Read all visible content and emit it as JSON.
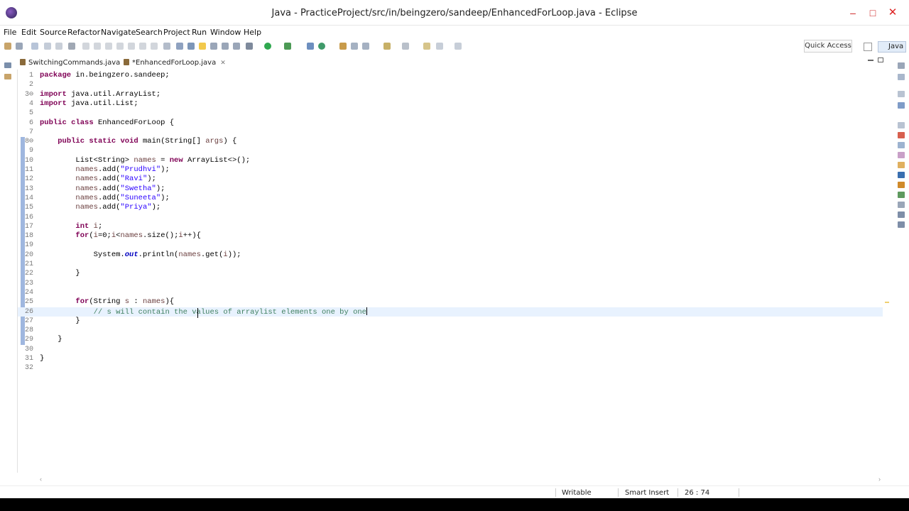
{
  "window": {
    "title": "Java - PracticeProject/src/in/beingzero/sandeep/EnhancedForLoop.java - Eclipse",
    "minimize": "–",
    "maximize": "□",
    "close": "✕"
  },
  "menu": [
    "File",
    "Edit",
    "Source",
    "Refactor",
    "Navigate",
    "Search",
    "Project",
    "Run",
    "Window",
    "Help"
  ],
  "toolbar": {
    "quick_access": "Quick Access",
    "perspective": "Java"
  },
  "tabs": [
    {
      "label": "SwitchingCommands.java",
      "active": false
    },
    {
      "label": "*EnhancedForLoop.java",
      "active": true,
      "close": "✕"
    }
  ],
  "editor": {
    "current_line": 26,
    "lines": [
      {
        "n": "1",
        "tokens": [
          [
            "kw",
            "package"
          ],
          [
            "p",
            " in.beingzero.sandeep;"
          ]
        ]
      },
      {
        "n": "2",
        "tokens": []
      },
      {
        "n": "3⊖",
        "tokens": [
          [
            "kw",
            "import"
          ],
          [
            "p",
            " java.util.ArrayList;"
          ]
        ]
      },
      {
        "n": "4",
        "tokens": [
          [
            "kw",
            "import"
          ],
          [
            "p",
            " java.util.List;"
          ]
        ]
      },
      {
        "n": "5",
        "tokens": []
      },
      {
        "n": "6",
        "tokens": [
          [
            "kw",
            "public"
          ],
          [
            "p",
            " "
          ],
          [
            "kw",
            "class"
          ],
          [
            "p",
            " EnhancedForLoop {"
          ]
        ]
      },
      {
        "n": "7",
        "tokens": []
      },
      {
        "n": "8⊖",
        "tokens": [
          [
            "p",
            "    "
          ],
          [
            "kw",
            "public"
          ],
          [
            "p",
            " "
          ],
          [
            "kw",
            "static"
          ],
          [
            "p",
            " "
          ],
          [
            "kw",
            "void"
          ],
          [
            "p",
            " main(String[] "
          ],
          [
            "var",
            "args"
          ],
          [
            "p",
            ") {"
          ]
        ]
      },
      {
        "n": "9",
        "tokens": []
      },
      {
        "n": "10",
        "tokens": [
          [
            "p",
            "        List<String> "
          ],
          [
            "var",
            "names"
          ],
          [
            "p",
            " = "
          ],
          [
            "kw",
            "new"
          ],
          [
            "p",
            " ArrayList<>();"
          ]
        ]
      },
      {
        "n": "11",
        "tokens": [
          [
            "p",
            "        "
          ],
          [
            "var",
            "names"
          ],
          [
            "p",
            ".add("
          ],
          [
            "str",
            "\"Prudhvi\""
          ],
          [
            "p",
            ");"
          ]
        ]
      },
      {
        "n": "12",
        "tokens": [
          [
            "p",
            "        "
          ],
          [
            "var",
            "names"
          ],
          [
            "p",
            ".add("
          ],
          [
            "str",
            "\"Ravi\""
          ],
          [
            "p",
            ");"
          ]
        ]
      },
      {
        "n": "13",
        "tokens": [
          [
            "p",
            "        "
          ],
          [
            "var",
            "names"
          ],
          [
            "p",
            ".add("
          ],
          [
            "str",
            "\"Swetha\""
          ],
          [
            "p",
            ");"
          ]
        ]
      },
      {
        "n": "14",
        "tokens": [
          [
            "p",
            "        "
          ],
          [
            "var",
            "names"
          ],
          [
            "p",
            ".add("
          ],
          [
            "str",
            "\"Suneeta\""
          ],
          [
            "p",
            ");"
          ]
        ]
      },
      {
        "n": "15",
        "tokens": [
          [
            "p",
            "        "
          ],
          [
            "var",
            "names"
          ],
          [
            "p",
            ".add("
          ],
          [
            "str",
            "\"Priya\""
          ],
          [
            "p",
            ");"
          ]
        ]
      },
      {
        "n": "16",
        "tokens": []
      },
      {
        "n": "17",
        "tokens": [
          [
            "p",
            "        "
          ],
          [
            "kw",
            "int"
          ],
          [
            "p",
            " "
          ],
          [
            "var",
            "i"
          ],
          [
            "p",
            ";"
          ]
        ]
      },
      {
        "n": "18",
        "tokens": [
          [
            "p",
            "        "
          ],
          [
            "kw",
            "for"
          ],
          [
            "p",
            "("
          ],
          [
            "var",
            "i"
          ],
          [
            "p",
            "=0;"
          ],
          [
            "var",
            "i"
          ],
          [
            "p",
            "<"
          ],
          [
            "var",
            "names"
          ],
          [
            "p",
            ".size();"
          ],
          [
            "var",
            "i"
          ],
          [
            "p",
            "++){"
          ]
        ]
      },
      {
        "n": "19",
        "tokens": []
      },
      {
        "n": "20",
        "tokens": [
          [
            "p",
            "            System."
          ],
          [
            "fld",
            "out"
          ],
          [
            "p",
            ".println("
          ],
          [
            "var",
            "names"
          ],
          [
            "p",
            ".get("
          ],
          [
            "var",
            "i"
          ],
          [
            "p",
            "));"
          ]
        ]
      },
      {
        "n": "21",
        "tokens": []
      },
      {
        "n": "22",
        "tokens": [
          [
            "p",
            "        }"
          ]
        ]
      },
      {
        "n": "23",
        "tokens": []
      },
      {
        "n": "24",
        "tokens": []
      },
      {
        "n": "25",
        "tokens": [
          [
            "p",
            "        "
          ],
          [
            "kw",
            "for"
          ],
          [
            "p",
            "(String "
          ],
          [
            "var",
            "s"
          ],
          [
            "p",
            " : "
          ],
          [
            "var",
            "names"
          ],
          [
            "p",
            "){"
          ]
        ]
      },
      {
        "n": "26",
        "tokens": [
          [
            "p",
            "            "
          ],
          [
            "cmt",
            "// s will contain the values of arraylist elements one by one"
          ]
        ]
      },
      {
        "n": "27",
        "tokens": [
          [
            "p",
            "        }"
          ]
        ]
      },
      {
        "n": "28",
        "tokens": []
      },
      {
        "n": "29",
        "tokens": [
          [
            "p",
            "    }"
          ]
        ]
      },
      {
        "n": "30",
        "tokens": []
      },
      {
        "n": "31",
        "tokens": [
          [
            "p",
            "}"
          ]
        ]
      },
      {
        "n": "32",
        "tokens": []
      }
    ]
  },
  "status": {
    "writable": "Writable",
    "insert_mode": "Smart Insert",
    "position": "26 : 74"
  },
  "colors": {
    "keyword": "#7f0055",
    "string": "#2a00ff",
    "comment": "#3f7f5f",
    "current_line": "#e8f2fe"
  }
}
